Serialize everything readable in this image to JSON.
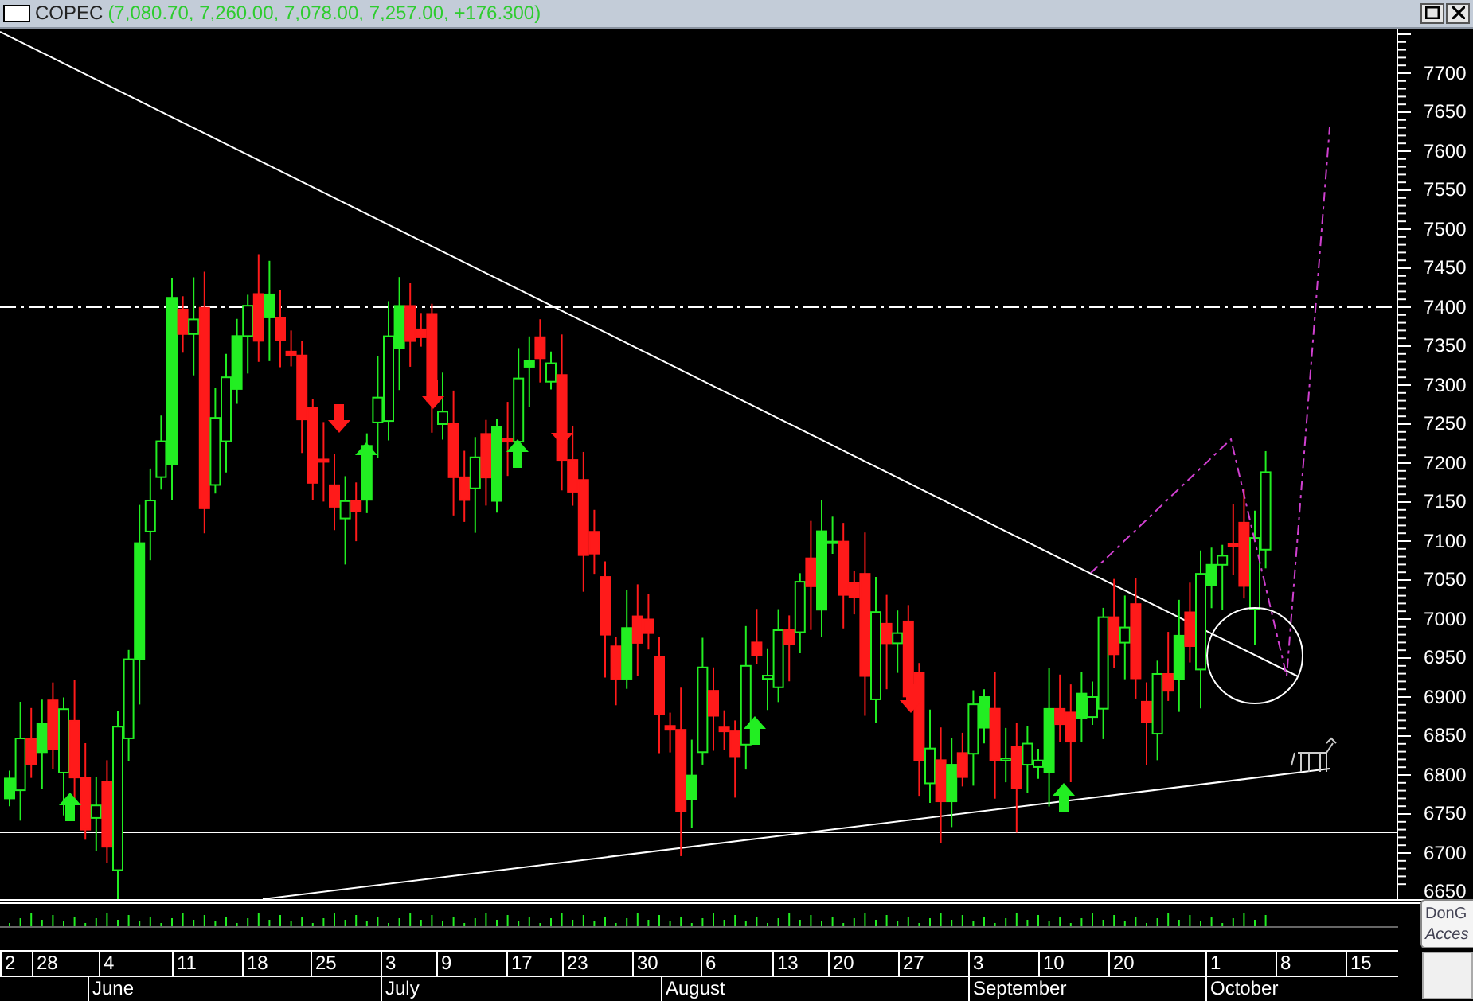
{
  "window": {
    "symbol": "COPEC",
    "quote": "(7,080.70, 7,260.00, 7,078.00, 7,257.00, +176.300)"
  },
  "price_axis": [
    "7700",
    "7650",
    "7600",
    "7550",
    "7500",
    "7450",
    "7400",
    "7350",
    "7300",
    "7250",
    "7200",
    "7150",
    "7100",
    "7050",
    "7000",
    "6950",
    "6900",
    "6850",
    "6800",
    "6750",
    "6700",
    "6650"
  ],
  "date_axis": {
    "days": [
      "2",
      "28",
      "4",
      "11",
      "18",
      "25",
      "3",
      "9",
      "17",
      "23",
      "30",
      "6",
      "13",
      "20",
      "27",
      "3",
      "10",
      "20",
      "1",
      "8",
      "15"
    ],
    "months": [
      "June",
      "July",
      "August",
      "September",
      "October"
    ]
  },
  "tooltip": {
    "line_1": "DonG",
    "line_2": "Acces"
  }
}
